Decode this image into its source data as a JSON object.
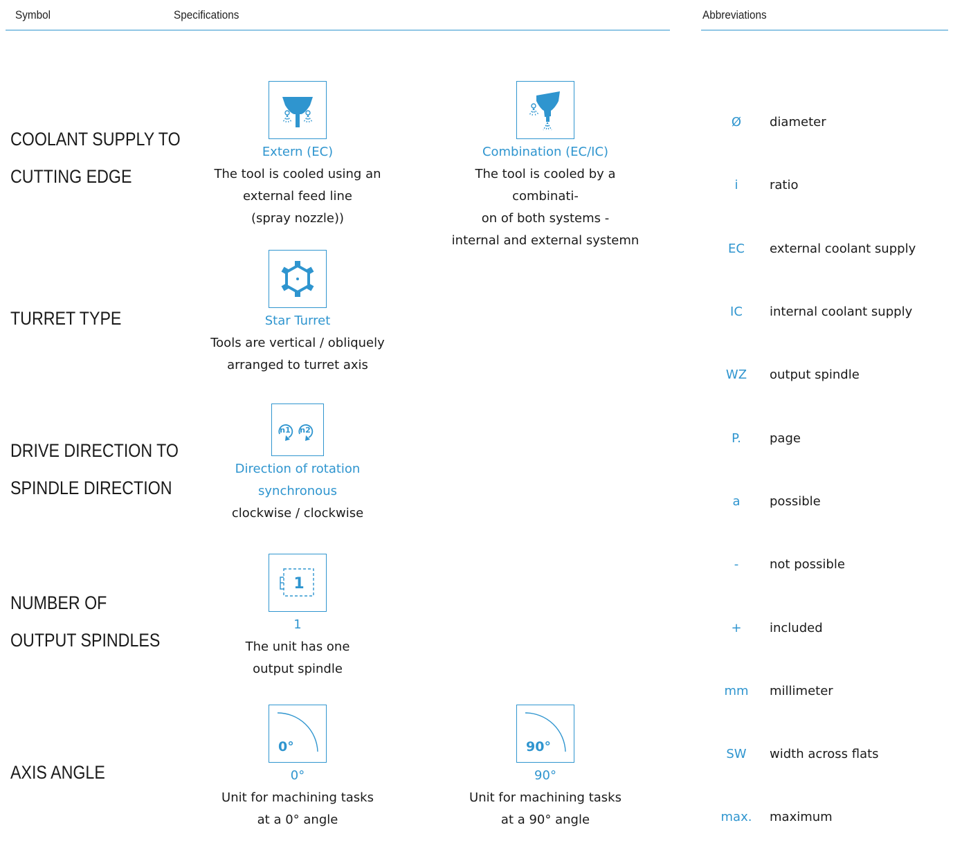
{
  "header": {
    "symbol": "Symbol",
    "specifications": "Specifications",
    "abbreviations": "Abbreviations"
  },
  "sections": {
    "coolant": {
      "label_line1": "COOLANT SUPPLY TO",
      "label_line2": "CUTTING EDGE",
      "items": [
        {
          "icon": "external-coolant-nozzle-icon",
          "title": "Extern (EC)",
          "lines": [
            "The tool is cooled using an",
            "external feed line",
            "(spray nozzle))"
          ]
        },
        {
          "icon": "combination-coolant-icon",
          "title": "Combination (EC/IC)",
          "lines": [
            "The tool is cooled by a combinati-",
            "on of both systems -",
            "internal and external systemn"
          ]
        }
      ]
    },
    "turret": {
      "label_line1": "TURRET TYPE",
      "items": [
        {
          "icon": "star-turret-icon",
          "title": "Star Turret",
          "lines": [
            "Tools are vertical / obliquely",
            "arranged to turret axis"
          ]
        }
      ]
    },
    "drive": {
      "label_line1": "DRIVE DIRECTION TO",
      "label_line2": "SPINDLE DIRECTION",
      "items": [
        {
          "icon": "rotation-direction-icon",
          "icon_text_1": "n1",
          "icon_text_2": "n2",
          "title_line1": "Direction of rotation",
          "title_line2": "synchronous",
          "lines": [
            "clockwise / clockwise"
          ]
        }
      ]
    },
    "spindles": {
      "label_line1": "NUMBER OF",
      "label_line2": "OUTPUT SPINDLES",
      "items": [
        {
          "icon": "single-output-spindle-icon",
          "icon_text": "1",
          "title": "1",
          "lines": [
            "The unit has one",
            "output spindle"
          ]
        }
      ]
    },
    "axis": {
      "label_line1": "AXIS ANGLE",
      "items": [
        {
          "icon": "axis-angle-0-icon",
          "icon_text": "0°",
          "title": "0°",
          "lines": [
            "Unit for machining tasks",
            "at a 0° angle"
          ]
        },
        {
          "icon": "axis-angle-90-icon",
          "icon_text": "90°",
          "title": "90°",
          "lines": [
            "Unit for machining tasks",
            "at a 90° angle"
          ]
        }
      ]
    }
  },
  "abbreviations": [
    {
      "key": "Ø",
      "value": "diameter"
    },
    {
      "key": "i",
      "value": "ratio"
    },
    {
      "key": "EC",
      "value": "external coolant supply"
    },
    {
      "key": "IC",
      "value": "internal coolant supply"
    },
    {
      "key": "WZ",
      "value": "output spindle"
    },
    {
      "key": "P.",
      "value": "page"
    },
    {
      "key": "a",
      "value": "possible"
    },
    {
      "key": "-",
      "value": "not possible"
    },
    {
      "key": "+",
      "value": "included"
    },
    {
      "key": "mm",
      "value": "millimeter"
    },
    {
      "key": "SW",
      "value": "width across flats"
    },
    {
      "key": "max.",
      "value": "maximum"
    }
  ],
  "colors": {
    "accent": "#2f95cf",
    "text": "#1a1a1a"
  }
}
